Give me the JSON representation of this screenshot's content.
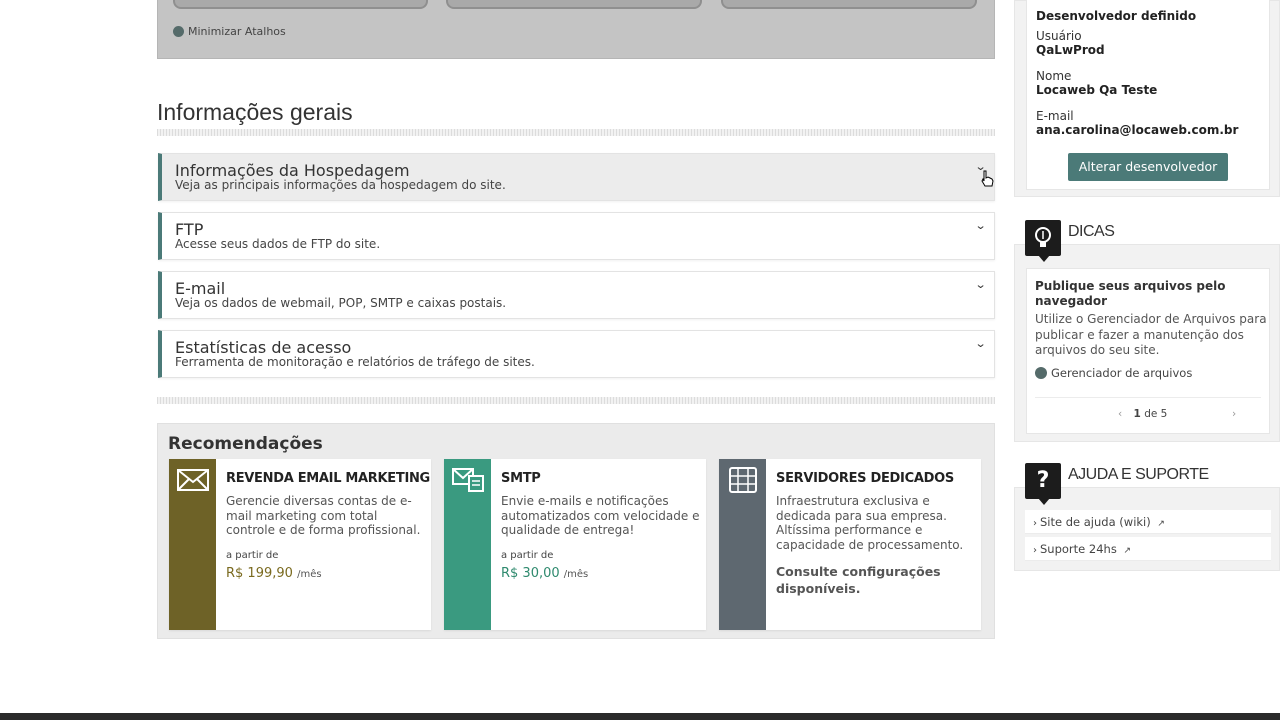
{
  "shortcuts": {
    "minimize_label": "Minimizar Atalhos"
  },
  "section_title": "Informações gerais",
  "accordion": [
    {
      "title": "Informações da Hospedagem",
      "description": "Veja as principais informações da hospedagem do site.",
      "active": true
    },
    {
      "title": "FTP",
      "description": "Acesse seus dados de FTP do site.",
      "active": false
    },
    {
      "title": "E-mail",
      "description": "Veja os dados de webmail, POP, SMTP e caixas postais.",
      "active": false
    },
    {
      "title": "Estatísticas de acesso",
      "description": "Ferramenta de monitoração e relatórios de tráfego de sites.",
      "active": false
    }
  ],
  "recommendations": {
    "title": "Recomendações",
    "cards": [
      {
        "title": "REVENDA EMAIL MARKETING",
        "description": "Gerencie diversas contas de e-mail marketing com total controle e de forma profissional.",
        "from_label": "a partir de",
        "price": "R$ 199,90",
        "period": "/mês",
        "color": "#6e6227",
        "price_color": "#7a6a1f",
        "icon": "envelope-icon"
      },
      {
        "title": "SMTP",
        "description": "Envie e-mails e notificações automatizados com velocidade e qualidade de entrega!",
        "from_label": "a partir de",
        "price": "R$ 30,00",
        "period": "/mês",
        "color": "#3a9a80",
        "price_color": "#2f8a6e",
        "icon": "envelope-server-icon"
      },
      {
        "title": "SERVIDORES DEDICADOS",
        "description": "Infraestrutura exclusiva e dedicada para sua empresa. Altíssima performance e capacidade de processamento.",
        "consult": "Consulte configurações disponíveis.",
        "color": "#5e6870",
        "icon": "server-icon"
      }
    ]
  },
  "developer": {
    "heading": "Desenvolvedor definido",
    "user_label": "Usuário",
    "user_value": "QaLwProd",
    "name_label": "Nome",
    "name_value": "Locaweb Qa Teste",
    "email_label": "E-mail",
    "email_value": "ana.carolina@locaweb.com.br",
    "button_label": "Alterar desenvolvedor"
  },
  "tips": {
    "header": "DICAS",
    "title": "Publique seus arquivos pelo navegador",
    "description": "Utilize o Gerenciador de Arquivos para publicar e fazer a manutenção dos arquivos do seu site.",
    "link": "Gerenciador de arquivos",
    "pager_current": "1",
    "pager_total": "de 5"
  },
  "help": {
    "header": "AJUDA E SUPORTE",
    "links": [
      "Site de ajuda (wiki)",
      "Suporte 24hs"
    ]
  },
  "colors": {
    "accent": "#4b7a78"
  }
}
